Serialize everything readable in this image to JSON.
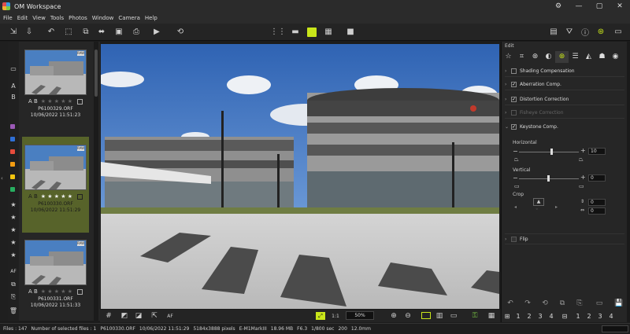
{
  "window": {
    "title": "OM Workspace"
  },
  "menu": [
    "File",
    "Edit",
    "View",
    "Tools",
    "Photos",
    "Window",
    "Camera",
    "Help"
  ],
  "window_controls": {
    "settings": "⚙",
    "minimize": "—",
    "maximize": "▢",
    "close": "✕"
  },
  "thumbnails": [
    {
      "rating_label": "A B",
      "stars": "★ ★ ★ ★ ★",
      "file": "P6100329.ORF",
      "date": "10/06/2022 11:51:23",
      "selected": false
    },
    {
      "rating_label": "A B",
      "stars": "★ ★ ★ ★ ★",
      "file": "P6100330.ORF",
      "date": "10/06/2022 11:51:29",
      "selected": true
    },
    {
      "rating_label": "A B",
      "stars": "★ ★ ★ ★ ★",
      "file": "P6100331.ORF",
      "date": "10/06/2022 11:51:33",
      "selected": false
    }
  ],
  "filter": {
    "ab_a": "A",
    "ab_b": "B",
    "af": "AF",
    "colors": [
      "#9b59b6",
      "#2f6fd6",
      "#e74c3c",
      "#f39c12",
      "#f1c40f",
      "#27ae60"
    ]
  },
  "viewer": {
    "zoom": "50%",
    "af_label": "AF"
  },
  "edit_panel": {
    "title": "Edit",
    "sections": [
      {
        "label": "Shading Compensation",
        "checked": false,
        "enabled": true
      },
      {
        "label": "Aberration Comp.",
        "checked": true,
        "enabled": true
      },
      {
        "label": "Distortion Correction",
        "checked": true,
        "enabled": true
      },
      {
        "label": "Fisheye Correction",
        "checked": false,
        "enabled": false
      },
      {
        "label": "Keystone Comp.",
        "checked": true,
        "enabled": true
      }
    ],
    "horizontal_label": "Horizontal",
    "horizontal_value": "10",
    "vertical_label": "Vertical",
    "vertical_value": "0",
    "crop_label": "Crop",
    "crop_value_1": "0",
    "crop_value_2": "0",
    "flip_label": "Flip",
    "bottom_numbers": [
      "1",
      "2",
      "3",
      "4"
    ],
    "bottom_numbers_b": [
      "1",
      "2",
      "3",
      "4"
    ]
  },
  "status": {
    "files": "Files : 147",
    "selected": "Number of selected files : 1",
    "file": "P6100330.ORF",
    "datetime": "10/06/2022 11:51:29",
    "pixels": "5184x3888 pixels",
    "camera": "E-M1MarkIII",
    "size": "18.96 MB",
    "fnum": "F6.3",
    "shutter": "1/800 sec",
    "iso": "200",
    "focal": "12.0mm"
  },
  "colors": {
    "accent": "#c9e61a",
    "selected_thumb": "#57632a"
  }
}
